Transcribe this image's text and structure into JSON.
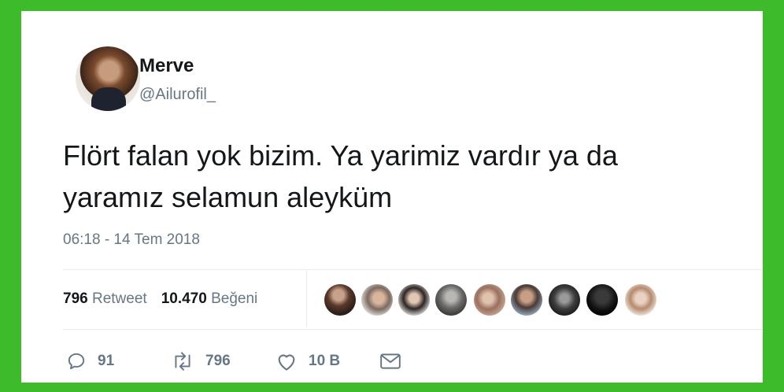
{
  "user": {
    "name": "Merve",
    "handle": "@Ailurofil_"
  },
  "tweet": {
    "text_line1": "Flört falan yok bizim. Ya yarimiz vardır ya da",
    "text_line2": "yaramız selamun aleyküm",
    "timestamp": "06:18 - 14 Tem 2018"
  },
  "stats": {
    "retweets_count": "796",
    "retweets_label": "Retweet",
    "likes_count": "10.470",
    "likes_label": "Beğeni"
  },
  "actions": {
    "reply_count": "91",
    "retweet_count": "796",
    "like_count": "10 B"
  },
  "colors": {
    "background_green": "#3dbb2a",
    "text": "#14171a",
    "secondary": "#657786"
  },
  "icons": [
    "reply-icon",
    "retweet-icon",
    "like-icon",
    "message-icon"
  ]
}
